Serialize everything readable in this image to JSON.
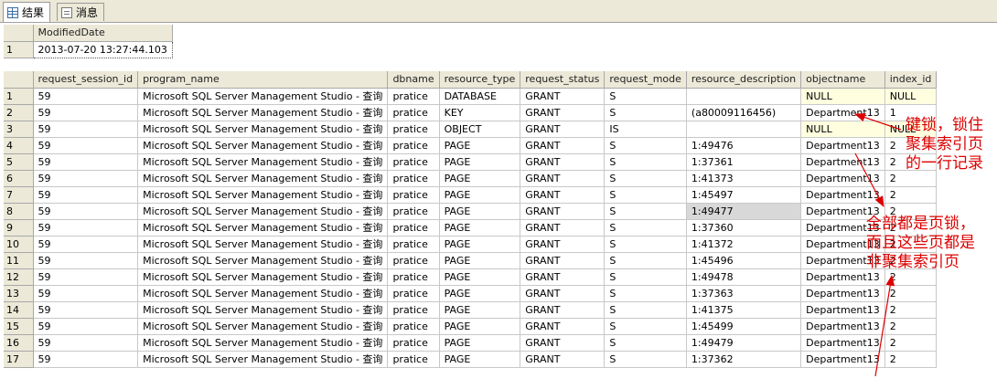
{
  "tabs": [
    {
      "label": "结果",
      "icon": "grid-icon",
      "active": true
    },
    {
      "label": "消息",
      "icon": "message-icon",
      "active": false
    }
  ],
  "result1": {
    "columns": [
      "ModifiedDate"
    ],
    "rows": [
      {
        "num": "1",
        "cells": [
          "2013-07-20 13:27:44.103"
        ]
      }
    ]
  },
  "result2": {
    "columns": [
      "request_session_id",
      "program_name",
      "dbname",
      "resource_type",
      "request_status",
      "request_mode",
      "resource_description",
      "objectname",
      "index_id"
    ],
    "rows": [
      {
        "num": "1",
        "cells": [
          "59",
          "Microsoft SQL Server Management Studio - 查询",
          "pratice",
          "DATABASE",
          "GRANT",
          "S",
          "",
          "NULL",
          "NULL"
        ]
      },
      {
        "num": "2",
        "cells": [
          "59",
          "Microsoft SQL Server Management Studio - 查询",
          "pratice",
          "KEY",
          "GRANT",
          "S",
          "(a80009116456)",
          "Department13",
          "1"
        ]
      },
      {
        "num": "3",
        "cells": [
          "59",
          "Microsoft SQL Server Management Studio - 查询",
          "pratice",
          "OBJECT",
          "GRANT",
          "IS",
          "",
          "NULL",
          "NULL"
        ]
      },
      {
        "num": "4",
        "cells": [
          "59",
          "Microsoft SQL Server Management Studio - 查询",
          "pratice",
          "PAGE",
          "GRANT",
          "S",
          "1:49476",
          "Department13",
          "2"
        ]
      },
      {
        "num": "5",
        "cells": [
          "59",
          "Microsoft SQL Server Management Studio - 查询",
          "pratice",
          "PAGE",
          "GRANT",
          "S",
          "1:37361",
          "Department13",
          "2"
        ]
      },
      {
        "num": "6",
        "cells": [
          "59",
          "Microsoft SQL Server Management Studio - 查询",
          "pratice",
          "PAGE",
          "GRANT",
          "S",
          "1:41373",
          "Department13",
          "2"
        ]
      },
      {
        "num": "7",
        "cells": [
          "59",
          "Microsoft SQL Server Management Studio - 查询",
          "pratice",
          "PAGE",
          "GRANT",
          "S",
          "1:45497",
          "Department13",
          "2"
        ]
      },
      {
        "num": "8",
        "cells": [
          "59",
          "Microsoft SQL Server Management Studio - 查询",
          "pratice",
          "PAGE",
          "GRANT",
          "S",
          "1:49477",
          "Department13",
          "2"
        ]
      },
      {
        "num": "9",
        "cells": [
          "59",
          "Microsoft SQL Server Management Studio - 查询",
          "pratice",
          "PAGE",
          "GRANT",
          "S",
          "1:37360",
          "Department13",
          "2"
        ]
      },
      {
        "num": "10",
        "cells": [
          "59",
          "Microsoft SQL Server Management Studio - 查询",
          "pratice",
          "PAGE",
          "GRANT",
          "S",
          "1:41372",
          "Department13",
          "2"
        ]
      },
      {
        "num": "11",
        "cells": [
          "59",
          "Microsoft SQL Server Management Studio - 查询",
          "pratice",
          "PAGE",
          "GRANT",
          "S",
          "1:45496",
          "Department13",
          "2"
        ]
      },
      {
        "num": "12",
        "cells": [
          "59",
          "Microsoft SQL Server Management Studio - 查询",
          "pratice",
          "PAGE",
          "GRANT",
          "S",
          "1:49478",
          "Department13",
          "2"
        ]
      },
      {
        "num": "13",
        "cells": [
          "59",
          "Microsoft SQL Server Management Studio - 查询",
          "pratice",
          "PAGE",
          "GRANT",
          "S",
          "1:37363",
          "Department13",
          "2"
        ]
      },
      {
        "num": "14",
        "cells": [
          "59",
          "Microsoft SQL Server Management Studio - 查询",
          "pratice",
          "PAGE",
          "GRANT",
          "S",
          "1:41375",
          "Department13",
          "2"
        ]
      },
      {
        "num": "15",
        "cells": [
          "59",
          "Microsoft SQL Server Management Studio - 查询",
          "pratice",
          "PAGE",
          "GRANT",
          "S",
          "1:45499",
          "Department13",
          "2"
        ]
      },
      {
        "num": "16",
        "cells": [
          "59",
          "Microsoft SQL Server Management Studio - 查询",
          "pratice",
          "PAGE",
          "GRANT",
          "S",
          "1:49479",
          "Department13",
          "2"
        ]
      },
      {
        "num": "17",
        "cells": [
          "59",
          "Microsoft SQL Server Management Studio - 查询",
          "pratice",
          "PAGE",
          "GRANT",
          "S",
          "1:37362",
          "Department13",
          "2"
        ]
      }
    ]
  },
  "annotations": {
    "key_lock": [
      "键锁，锁住",
      "聚集索引页",
      "的一行记录"
    ],
    "page_lock": [
      "全部都是页锁，",
      "而且这些页都是",
      "非聚集索引页"
    ],
    "color": "#dd0000"
  },
  "colors": {
    "null_cell_bg": "#ffffe0",
    "selected_cell_bg": "#d8d8d8",
    "header_bg": "#ece9d8"
  }
}
